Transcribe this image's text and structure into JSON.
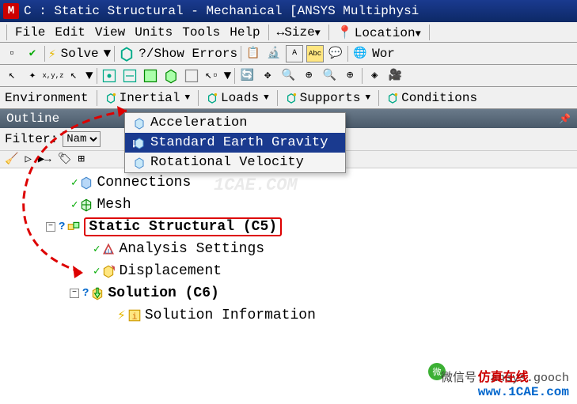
{
  "title": "C : Static Structural - Mechanical [ANSYS Multiphysi",
  "app_letter": "M",
  "menubar": {
    "file": "File",
    "edit": "Edit",
    "view": "View",
    "units": "Units",
    "tools": "Tools",
    "help": "Help",
    "size": "↔Size",
    "location": "Location",
    "arrow": "▼"
  },
  "toolbar": {
    "solve": "Solve",
    "show_errors": "?/Show Errors",
    "suffix": "Wor",
    "arrow": "▼"
  },
  "envbar": {
    "environment": "Environment",
    "inertial": "Inertial",
    "loads": "Loads",
    "supports": "Supports",
    "conditions": "Conditions",
    "arrow": "▼"
  },
  "outline_header": "Outline",
  "filter": {
    "label": "Filter:",
    "value": "Nam"
  },
  "dropdown": {
    "items": [
      {
        "label": "Acceleration",
        "selected": false
      },
      {
        "label": "Standard Earth Gravity",
        "selected": true
      },
      {
        "label": "Rotational Velocity",
        "selected": false
      }
    ]
  },
  "tree": {
    "connections": "Connections",
    "mesh": "Mesh",
    "static_structural": "Static Structural (C5)",
    "analysis_settings": "Analysis Settings",
    "displacement": "Displacement",
    "solution": "Solution (C6)",
    "solution_info": "Solution Information"
  },
  "watermarks": {
    "center": "1CAE.COM",
    "wechat": "微信号: ansys.gooch",
    "brand": "仿真在线",
    "url": "www.1CAE.com"
  }
}
